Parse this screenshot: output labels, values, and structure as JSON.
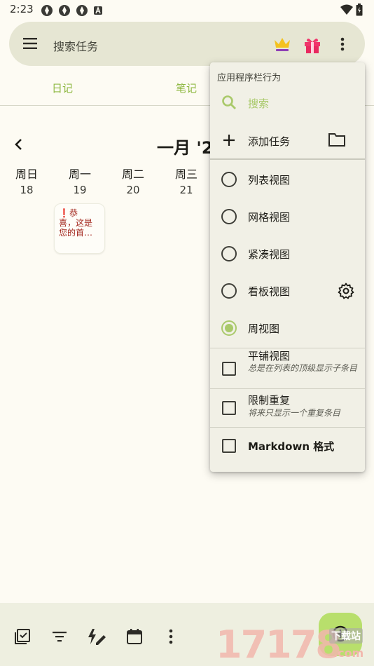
{
  "status_bar": {
    "time": "2:23"
  },
  "search": {
    "placeholder": "搜索任务"
  },
  "tabs": [
    {
      "label": "日记"
    },
    {
      "label": "笔记"
    }
  ],
  "calendar": {
    "month_title": "一月 '2",
    "days": [
      {
        "name": "周日",
        "num": "18"
      },
      {
        "name": "周一",
        "num": "19"
      },
      {
        "name": "周二",
        "num": "20"
      },
      {
        "name": "周三",
        "num": "21"
      }
    ],
    "task": {
      "marker": "❗",
      "text_line1": "恭",
      "text_rest": "喜，这是您的首…"
    }
  },
  "menu": {
    "header": "应用程序栏行为",
    "search_label": "搜索",
    "add_task_label": "添加任务",
    "views": [
      {
        "label": "列表视图",
        "selected": false
      },
      {
        "label": "网格视图",
        "selected": false
      },
      {
        "label": "紧凑视图",
        "selected": false
      },
      {
        "label": "看板视图",
        "selected": false
      },
      {
        "label": "周视图",
        "selected": true
      }
    ],
    "options": [
      {
        "label": "平铺视图",
        "sub": "总是在列表的顶级显示子条目",
        "checked": false
      },
      {
        "label": "限制重复",
        "sub": "将来只显示一个重复条目",
        "checked": false
      },
      {
        "label": "Markdown 格式",
        "sub": "",
        "checked": false
      }
    ]
  },
  "watermark": {
    "digits": "17178",
    "site": "下载站",
    "domain": ".com"
  },
  "colors": {
    "accent": "#8fb842",
    "radio_selected": "#a9c96a",
    "fab": "#b8df6c",
    "task_text": "#a3281e"
  }
}
